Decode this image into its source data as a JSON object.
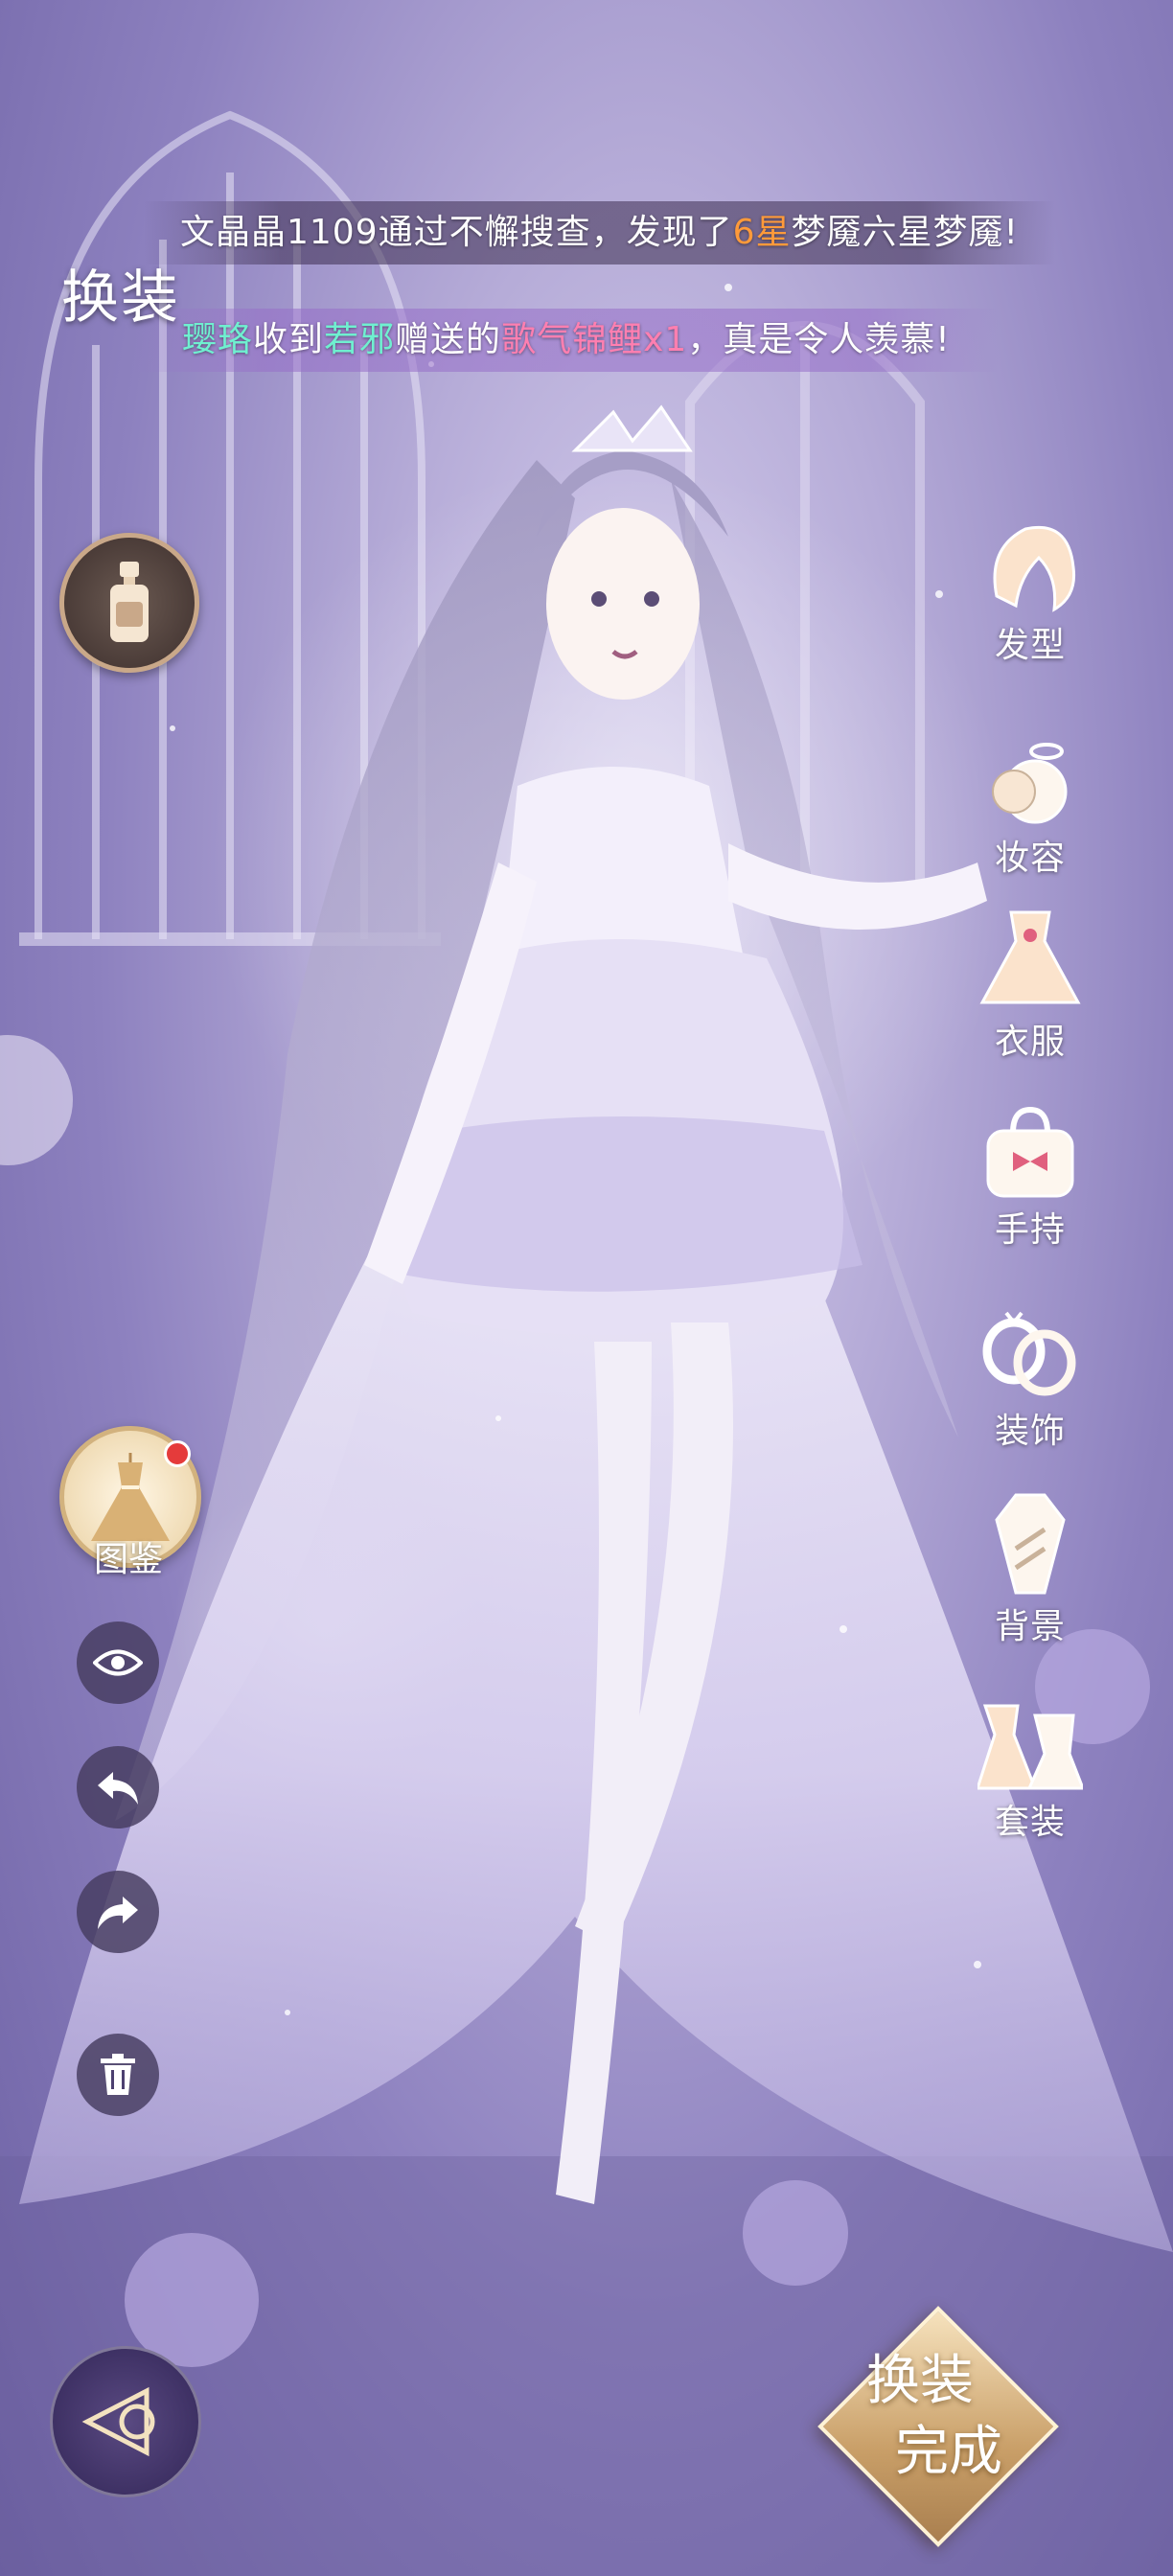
{
  "header": {
    "title": "换装"
  },
  "banners": {
    "first": {
      "prefix": "文晶晶1109通过不懈搜查，发现了",
      "highlight": "6星",
      "suffix": "梦魇六星梦魇!"
    },
    "second": {
      "user": "璎珞",
      "mid1": "收到",
      "sender": "若邪",
      "mid2": "赠送的",
      "item": "歌气锦鲤x1",
      "suffix": "，真是令人羡慕!"
    }
  },
  "left_tools": {
    "perfume_icon": "perfume-bottle-icon",
    "catalog_label": "图鉴",
    "catalog_has_badge": true,
    "eye_icon": "eye-icon",
    "undo_icon": "undo-icon",
    "redo_icon": "redo-icon",
    "delete_icon": "trash-icon",
    "back_icon": "back-arrow-icon"
  },
  "categories": [
    {
      "label": "发型",
      "icon": "hair-icon"
    },
    {
      "label": "妆容",
      "icon": "makeup-icon"
    },
    {
      "label": "衣服",
      "icon": "clothes-icon"
    },
    {
      "label": "手持",
      "icon": "handbag-icon"
    },
    {
      "label": "装饰",
      "icon": "rings-icon"
    },
    {
      "label": "背景",
      "icon": "background-icon"
    },
    {
      "label": "套装",
      "icon": "outfit-set-icon"
    }
  ],
  "done_button": {
    "line1": "换装",
    "line2": "完成"
  },
  "colors": {
    "highlight_orange": "#ff9a3a",
    "name_teal": "#6ff0d0",
    "item_pink": "#ff7fb0",
    "accent_gold": "#c99f68"
  }
}
